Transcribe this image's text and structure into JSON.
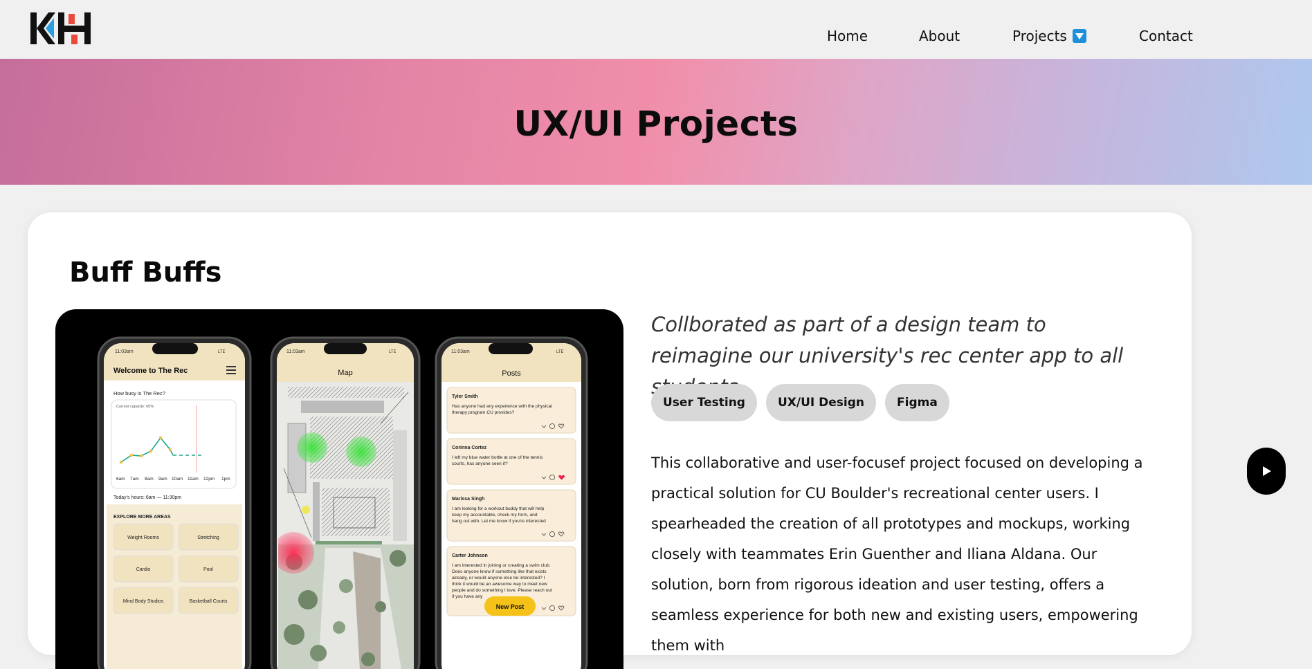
{
  "nav": {
    "logo_text": "KH",
    "links": [
      {
        "label": "Home"
      },
      {
        "label": "About"
      },
      {
        "label": "Projects"
      },
      {
        "label": "Contact"
      }
    ]
  },
  "hero": {
    "title": "UX/UI Projects"
  },
  "project": {
    "title": "Buff Buffs",
    "tagline": "Collborated as part of a design team to reimagine our university's rec center app to all students",
    "tags": [
      "User Testing",
      "UX/UI Design",
      "Figma"
    ],
    "description": "This collaborative and user-focusef project focused on developing a practical solution for CU Boulder's recreational center users. I spearheaded the creation of all prototypes and mockups, working closely with teammates Erin Guenther and Iliana Aldana. Our solution, born from rigorous ideation and user testing, offers a seamless experience for both new and existing users, empowering them with"
  },
  "mockup": {
    "status_time": "11:03am",
    "status_net": "LTE",
    "home": {
      "title": "Welcome to The Rec",
      "question": "How busy is The Rec?",
      "capacity": "Current capacity: 65%",
      "hours_axis": [
        "6am",
        "7am",
        "8am",
        "9am",
        "10am",
        "11am",
        "12pm",
        "1pm"
      ],
      "today_hours": "Today's hours: 6am — 11:30pm",
      "explore_title": "EXPLORE MORE AREAS",
      "areas": [
        "Weight Rooms",
        "Stretching",
        "Cardio",
        "Pool",
        "Mind Body Studios",
        "Basketball Courts"
      ]
    },
    "map": {
      "title": "Map"
    },
    "posts": {
      "title": "Posts",
      "items": [
        {
          "author": "Tyler Smith",
          "text1": "Has anyone had any experience with the physical",
          "text2": "therapy program CU provides?"
        },
        {
          "author": "Corinna Cortez",
          "text1": "I left my blue water bottle at one of the tennis",
          "text2": "courts, has anyone seen it?"
        },
        {
          "author": "Marissa Singh",
          "text1": "I am looking for a workout buddy that will help",
          "text2": "keep my accountable, check my form, and",
          "text3": "hang out with. Let me know if you're interested"
        },
        {
          "author": "Carter Johnson",
          "text1": "I am interested in joining or creating a swim club.",
          "text2": "Does anyone know if something like that exists",
          "text3": "already, or would anyone else be interested? I",
          "text4": "think it would be an awesome way to meet new",
          "text5": "people and do something I love. Please reach out",
          "text6": "if you have any"
        }
      ],
      "new_post": "New Post"
    }
  },
  "colors": {
    "accent_dropdown": "#1e8fd8",
    "logo_blue": "#2a9fe0",
    "logo_red": "#e84b3c",
    "heart": "#e8204a",
    "new_post": "#f5c21a",
    "app_header": "#f2e3c0",
    "map_hotspot_green": "#3be23b",
    "map_hotspot_red": "#ff2b55"
  }
}
